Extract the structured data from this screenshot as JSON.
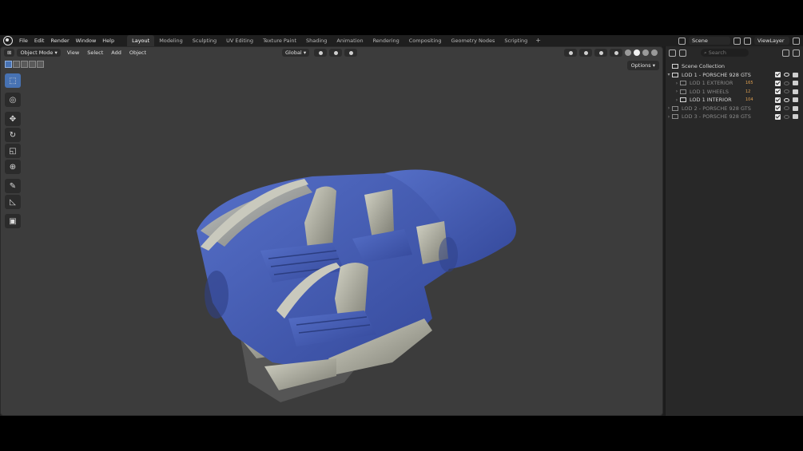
{
  "menubar": {
    "items": [
      "File",
      "Edit",
      "Render",
      "Window",
      "Help"
    ],
    "workspaces": [
      "Layout",
      "Modeling",
      "Sculpting",
      "UV Editing",
      "Texture Paint",
      "Shading",
      "Animation",
      "Rendering",
      "Compositing",
      "Geometry Nodes",
      "Scripting"
    ],
    "active_workspace": "Layout",
    "add_tab": "+",
    "scene": "Scene",
    "view_layer": "ViewLayer"
  },
  "viewport": {
    "mode": "Object Mode",
    "menus": [
      "View",
      "Select",
      "Add",
      "Object"
    ],
    "orientation": "Global",
    "options_label": "Options"
  },
  "outliner": {
    "search_placeholder": "Search",
    "scene_collection": "Scene Collection",
    "rows": [
      {
        "label": "LOD 1 - PORSCHE 928 GTS",
        "badge": "",
        "dim": false
      },
      {
        "label": "LOD 1 EXTERIOR",
        "badge": "165",
        "dim": true
      },
      {
        "label": "LOD 1 WHEELS",
        "badge": "12",
        "dim": true
      },
      {
        "label": "LOD 1 INTERIOR",
        "badge": "104",
        "dim": false
      },
      {
        "label": "LOD 2 - PORSCHE 928 GTS",
        "badge": "",
        "dim": true
      },
      {
        "label": "LOD 3 - PORSCHE 928 GTS",
        "badge": "",
        "dim": true
      }
    ]
  },
  "colors": {
    "accent": "#4772b3",
    "viewport_bg": "#3c3c3c",
    "model_blue": "#3f5ab0",
    "model_grey": "#a8a89c"
  }
}
